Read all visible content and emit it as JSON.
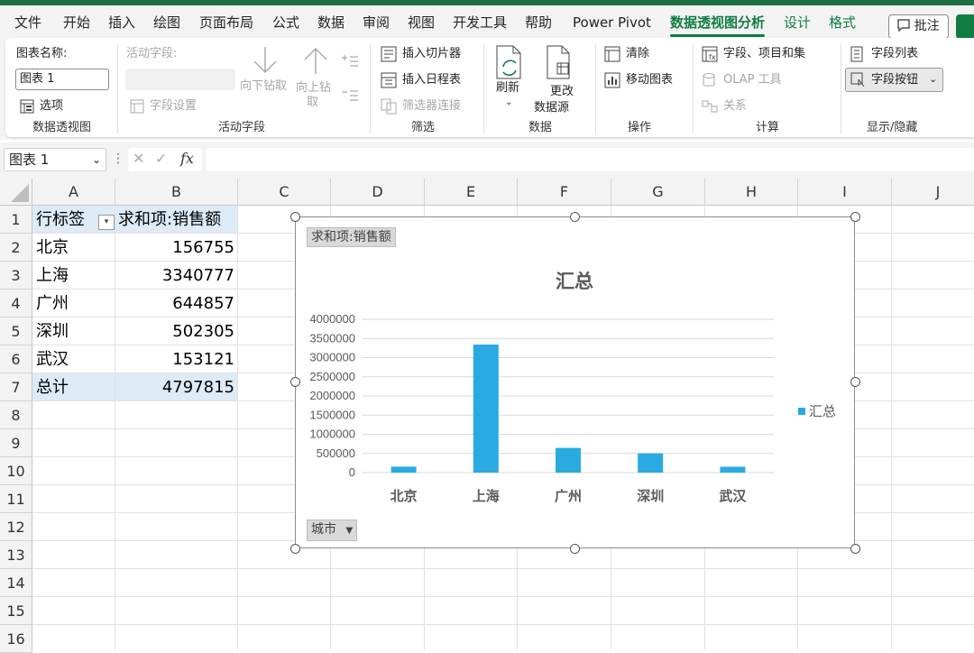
{
  "tabs": [
    "文件",
    "开始",
    "插入",
    "绘图",
    "页面布局",
    "公式",
    "数据",
    "审阅",
    "视图",
    "开发工具",
    "帮助",
    "Power Pivot",
    "数据透视图分析",
    "设计",
    "格式"
  ],
  "comment_label": "批注",
  "ribbon": {
    "chart_name_label": "图表名称:",
    "chart_name_value": "图表 1",
    "options_label": "选项",
    "group_pivotchart": "数据透视图",
    "active_field_label": "活动字段:",
    "field_settings": "字段设置",
    "drill_down": "向下钻取",
    "drill_up": "向上钻",
    "drill_up2": "取",
    "group_active_field": "活动字段",
    "insert_slicer": "插入切片器",
    "insert_timeline": "插入日程表",
    "filter_connections": "筛选器连接",
    "group_filter": "筛选",
    "refresh": "刷新",
    "change_source1": "更改",
    "change_source2": "数据源",
    "group_data": "数据",
    "clear": "清除",
    "move_chart": "移动图表",
    "group_actions": "操作",
    "fields_items_sets": "字段、项目和集",
    "olap_tools": "OLAP 工具",
    "relationships": "关系",
    "group_calculations": "计算",
    "field_list": "字段列表",
    "field_buttons": "字段按钮",
    "group_show": "显示/隐藏"
  },
  "formula_bar": {
    "name_box": "图表 1",
    "fx": "fx",
    "formula": ""
  },
  "columns": [
    "A",
    "B",
    "C",
    "D",
    "E",
    "F",
    "G",
    "H",
    "I",
    "J"
  ],
  "rows": [
    "1",
    "2",
    "3",
    "4",
    "5",
    "6",
    "7",
    "8",
    "9",
    "10",
    "11",
    "12",
    "13",
    "14",
    "15",
    "16"
  ],
  "pivot": {
    "header_label": "行标签",
    "header_value": "求和项:销售额",
    "rows": [
      {
        "label": "北京",
        "value": "156755"
      },
      {
        "label": "上海",
        "value": "3340777"
      },
      {
        "label": "广州",
        "value": "644857"
      },
      {
        "label": "深圳",
        "value": "502305"
      },
      {
        "label": "武汉",
        "value": "153121"
      }
    ],
    "total_label": "总计",
    "total_value": "4797815"
  },
  "chart_data": {
    "type": "bar",
    "title": "汇总",
    "value_field_button": "求和项:销售额",
    "axis_field_button": "城市",
    "categories": [
      "北京",
      "上海",
      "广州",
      "深圳",
      "武汉"
    ],
    "series": [
      {
        "name": "汇总",
        "values": [
          156755,
          3340777,
          644857,
          502305,
          153121
        ]
      }
    ],
    "yticks": [
      "4000000",
      "3500000",
      "3000000",
      "2500000",
      "2000000",
      "1500000",
      "1000000",
      "500000",
      "0"
    ],
    "ylim": [
      0,
      4000000
    ],
    "legend": "right",
    "grid": true,
    "colors": {
      "bar": "#29abe2"
    }
  }
}
